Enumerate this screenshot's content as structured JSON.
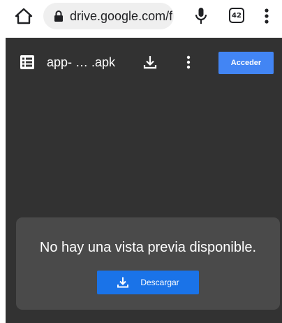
{
  "browser": {
    "url": "drive.google.com/f",
    "tab_count": "42",
    "icons": {
      "home": "home-icon",
      "lock": "lock-icon",
      "mic": "microphone-icon",
      "menu": "vertical-more-icon"
    }
  },
  "viewer": {
    "file_name": "app- … .apk",
    "signin_label": "Acceder",
    "icons": {
      "file": "file-list-icon",
      "download": "download-icon",
      "menu": "vertical-more-icon"
    },
    "colors": {
      "background": "#323232",
      "card": "#4a4a4a",
      "primary": "#1a73e8",
      "signin": "#4285f4"
    }
  },
  "no_preview": {
    "message": "No hay una vista previa disponible.",
    "download_label": "Descargar"
  }
}
